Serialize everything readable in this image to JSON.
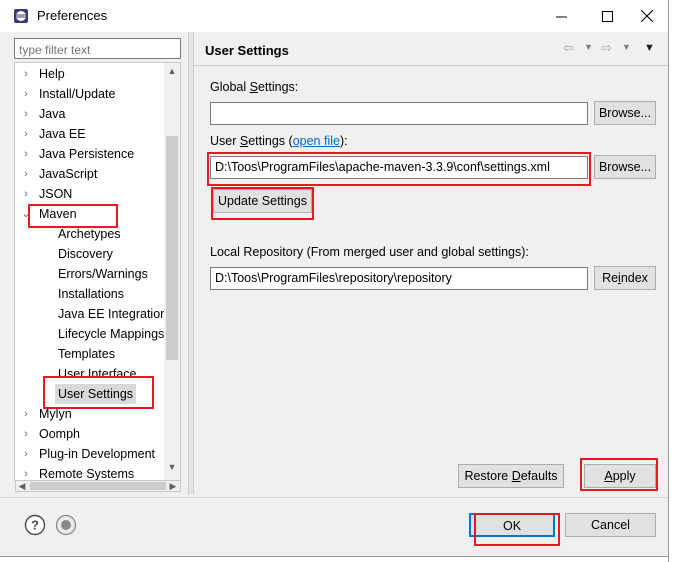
{
  "window": {
    "title": "Preferences",
    "minimize_glyph": "—",
    "maximize_glyph": "☐",
    "close_glyph": "✕"
  },
  "filter": {
    "placeholder": "type filter text"
  },
  "tree": {
    "items": [
      {
        "label": "Help",
        "twisty": "›"
      },
      {
        "label": "Install/Update",
        "twisty": "›"
      },
      {
        "label": "Java",
        "twisty": "›"
      },
      {
        "label": "Java EE",
        "twisty": "›"
      },
      {
        "label": "Java Persistence",
        "twisty": "›"
      },
      {
        "label": "JavaScript",
        "twisty": "›"
      },
      {
        "label": "JSON",
        "twisty": "›"
      },
      {
        "label": "Maven",
        "twisty": "⌄"
      },
      {
        "label": "Archetypes"
      },
      {
        "label": "Discovery"
      },
      {
        "label": "Errors/Warnings"
      },
      {
        "label": "Installations"
      },
      {
        "label": "Java EE Integration"
      },
      {
        "label": "Lifecycle Mappings"
      },
      {
        "label": "Templates"
      },
      {
        "label": "User Interface"
      },
      {
        "label": "User Settings"
      },
      {
        "label": "Mylyn",
        "twisty": "›"
      },
      {
        "label": "Oomph",
        "twisty": "›"
      },
      {
        "label": "Plug-in Development",
        "twisty": "›"
      },
      {
        "label": "Remote Systems",
        "twisty": "›"
      }
    ],
    "scroll_up": "▲",
    "scroll_down": "▼",
    "scroll_left": "◀",
    "scroll_right": "▶"
  },
  "page": {
    "title": "User Settings",
    "nav_back": "⇦",
    "nav_fwd": "⇨",
    "nav_menu": "▼",
    "view_menu": "▼",
    "global_settings_label_pre": "Global ",
    "global_settings_label_mn": "S",
    "global_settings_label_post": "ettings:",
    "global_settings_value": "",
    "user_settings_label_pre": "User ",
    "user_settings_label_mn": "S",
    "user_settings_label_mid": "ettings (",
    "user_settings_link": "open file",
    "user_settings_label_post": "):",
    "user_settings_value": "D:\\Toos\\ProgramFiles\\apache-maven-3.3.9\\conf\\settings.xml",
    "browse_label": "Browse...",
    "update_settings_label": "Update Settings",
    "local_repo_label": "Local Repository (From merged user and global settings):",
    "local_repo_value": "D:\\Toos\\ProgramFiles\\repository\\repository",
    "reindex_pre": "Re",
    "reindex_mn": "i",
    "reindex_post": "ndex",
    "restore_defaults_pre": "Restore ",
    "restore_defaults_mn": "D",
    "restore_defaults_post": "efaults",
    "apply_pre": "",
    "apply_mn": "A",
    "apply_post": "pply"
  },
  "footer": {
    "help_glyph": "?",
    "ok_label": "OK",
    "cancel_label": "Cancel"
  },
  "colors": {
    "highlight_red": "#e21b25",
    "link_blue": "#0066cc",
    "ok_border": "#0078d7"
  }
}
